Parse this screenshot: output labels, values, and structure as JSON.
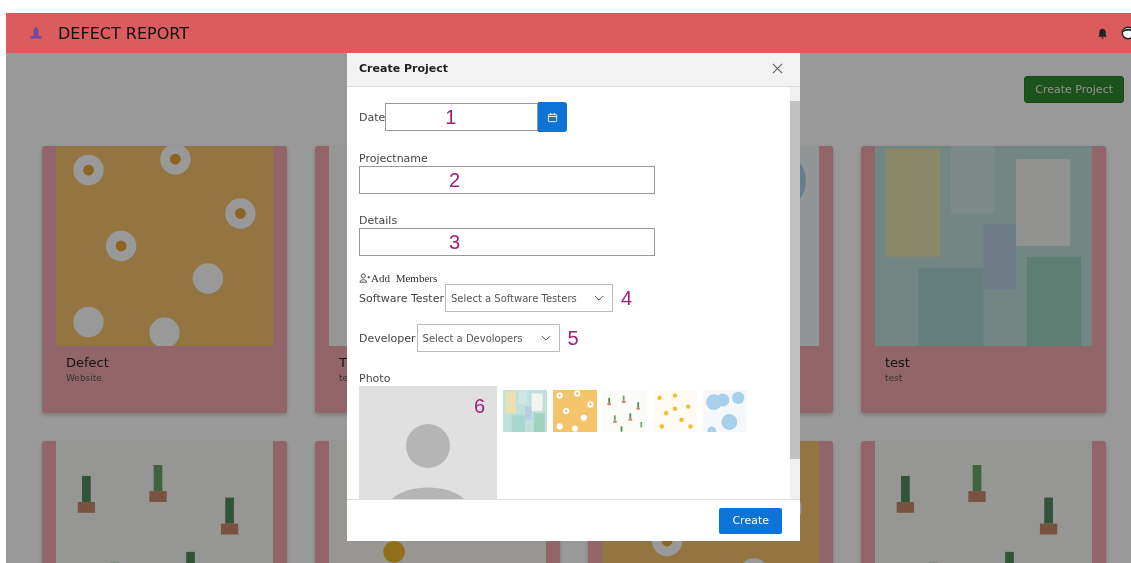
{
  "header": {
    "title": "DEFECT REPORT"
  },
  "create_project_button": "Create Project",
  "cards": [
    {
      "title": "Defect",
      "subtitle": "Website"
    },
    {
      "title": "T",
      "subtitle": "te"
    },
    {
      "kind": "picture"
    },
    {
      "title": "test",
      "subtitle": "test"
    }
  ],
  "cards_row_2": [
    {
      "kind": "picture"
    },
    {
      "kind": "picture"
    },
    {
      "kind": "picture"
    },
    {
      "kind": "picture"
    }
  ],
  "modal": {
    "title": "Create Project",
    "date": {
      "label": "Date",
      "annotation": "1"
    },
    "projectname": {
      "label": "Projectname",
      "annotation": "2"
    },
    "details": {
      "label": "Details",
      "annotation": "3"
    },
    "members_heading": "Add Members",
    "software_tester": {
      "label": "Software Tester",
      "placeholder": "Select a Software Testers",
      "annotation": "4"
    },
    "developer": {
      "label": "Developer",
      "placeholder": "Select a Devolopers",
      "annotation": "5"
    },
    "photo": {
      "label": "Photo",
      "annotation": "6",
      "thumbnails": [
        {
          "kind": "picture"
        },
        {
          "kind": "picture"
        },
        {
          "kind": "picture"
        },
        {
          "kind": "picture"
        },
        {
          "kind": "picture"
        }
      ]
    },
    "create_button": "Create"
  }
}
